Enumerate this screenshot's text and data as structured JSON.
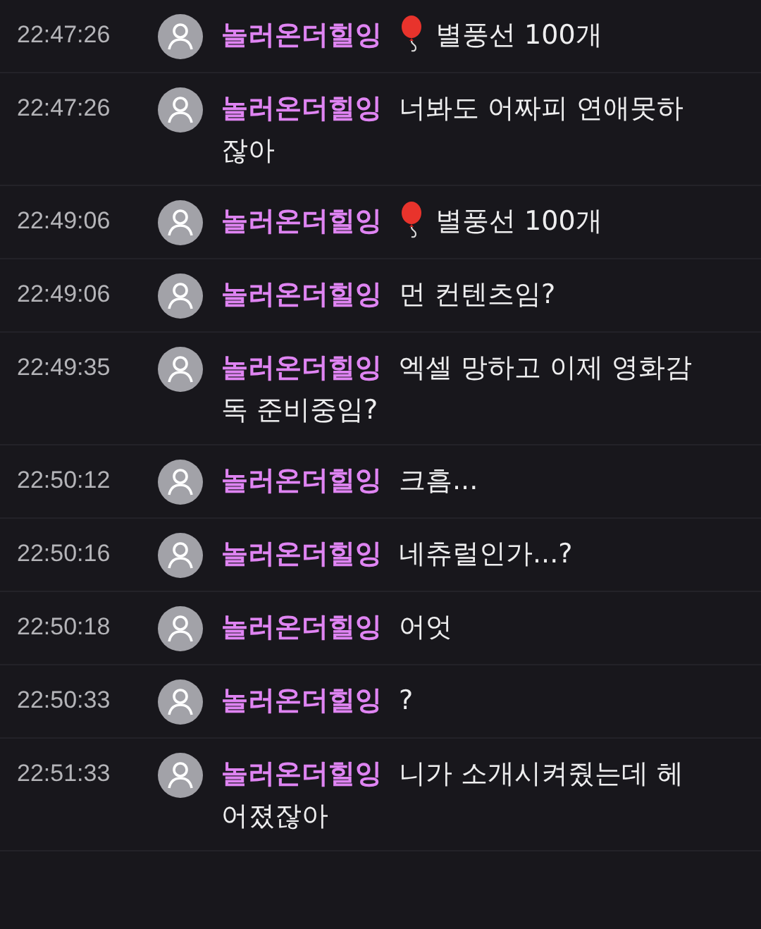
{
  "messages": [
    {
      "time": "22:47:26",
      "user": "놀러온더힐잉",
      "kind": "balloon",
      "lines": [
        "별풍선 100개"
      ]
    },
    {
      "time": "22:47:26",
      "user": "놀러온더힐잉",
      "kind": "text",
      "lines": [
        "너봐도 어짜피 연애못하",
        "잖아"
      ]
    },
    {
      "time": "22:49:06",
      "user": "놀러온더힐잉",
      "kind": "balloon",
      "lines": [
        "별풍선 100개"
      ]
    },
    {
      "time": "22:49:06",
      "user": "놀러온더힐잉",
      "kind": "text",
      "lines": [
        "먼 컨텐츠임?"
      ]
    },
    {
      "time": "22:49:35",
      "user": "놀러온더힐잉",
      "kind": "text",
      "lines": [
        "엑셀 망하고 이제 영화감",
        "독 준비중임?"
      ]
    },
    {
      "time": "22:50:12",
      "user": "놀러온더힐잉",
      "kind": "text",
      "lines": [
        "크흠..."
      ]
    },
    {
      "time": "22:50:16",
      "user": "놀러온더힐잉",
      "kind": "text",
      "lines": [
        "네츄럴인가...?"
      ]
    },
    {
      "time": "22:50:18",
      "user": "놀러온더힐잉",
      "kind": "text",
      "lines": [
        "어엇"
      ]
    },
    {
      "time": "22:50:33",
      "user": "놀러온더힐잉",
      "kind": "text",
      "lines": [
        "?"
      ]
    },
    {
      "time": "22:51:33",
      "user": "놀러온더힐잉",
      "kind": "text",
      "lines": [
        "니가 소개시켜줬는데 헤",
        "어졌잖아"
      ]
    }
  ]
}
